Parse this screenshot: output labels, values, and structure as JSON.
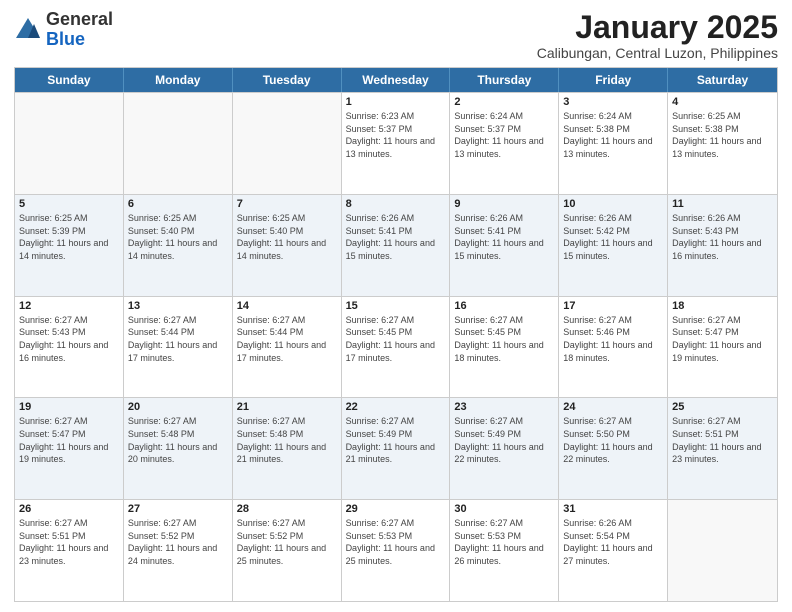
{
  "logo": {
    "general": "General",
    "blue": "Blue"
  },
  "header": {
    "month": "January 2025",
    "location": "Calibungan, Central Luzon, Philippines"
  },
  "weekdays": [
    "Sunday",
    "Monday",
    "Tuesday",
    "Wednesday",
    "Thursday",
    "Friday",
    "Saturday"
  ],
  "weeks": [
    [
      {
        "day": "",
        "sunrise": "",
        "sunset": "",
        "daylight": ""
      },
      {
        "day": "",
        "sunrise": "",
        "sunset": "",
        "daylight": ""
      },
      {
        "day": "",
        "sunrise": "",
        "sunset": "",
        "daylight": ""
      },
      {
        "day": "1",
        "sunrise": "Sunrise: 6:23 AM",
        "sunset": "Sunset: 5:37 PM",
        "daylight": "Daylight: 11 hours and 13 minutes."
      },
      {
        "day": "2",
        "sunrise": "Sunrise: 6:24 AM",
        "sunset": "Sunset: 5:37 PM",
        "daylight": "Daylight: 11 hours and 13 minutes."
      },
      {
        "day": "3",
        "sunrise": "Sunrise: 6:24 AM",
        "sunset": "Sunset: 5:38 PM",
        "daylight": "Daylight: 11 hours and 13 minutes."
      },
      {
        "day": "4",
        "sunrise": "Sunrise: 6:25 AM",
        "sunset": "Sunset: 5:38 PM",
        "daylight": "Daylight: 11 hours and 13 minutes."
      }
    ],
    [
      {
        "day": "5",
        "sunrise": "Sunrise: 6:25 AM",
        "sunset": "Sunset: 5:39 PM",
        "daylight": "Daylight: 11 hours and 14 minutes."
      },
      {
        "day": "6",
        "sunrise": "Sunrise: 6:25 AM",
        "sunset": "Sunset: 5:40 PM",
        "daylight": "Daylight: 11 hours and 14 minutes."
      },
      {
        "day": "7",
        "sunrise": "Sunrise: 6:25 AM",
        "sunset": "Sunset: 5:40 PM",
        "daylight": "Daylight: 11 hours and 14 minutes."
      },
      {
        "day": "8",
        "sunrise": "Sunrise: 6:26 AM",
        "sunset": "Sunset: 5:41 PM",
        "daylight": "Daylight: 11 hours and 15 minutes."
      },
      {
        "day": "9",
        "sunrise": "Sunrise: 6:26 AM",
        "sunset": "Sunset: 5:41 PM",
        "daylight": "Daylight: 11 hours and 15 minutes."
      },
      {
        "day": "10",
        "sunrise": "Sunrise: 6:26 AM",
        "sunset": "Sunset: 5:42 PM",
        "daylight": "Daylight: 11 hours and 15 minutes."
      },
      {
        "day": "11",
        "sunrise": "Sunrise: 6:26 AM",
        "sunset": "Sunset: 5:43 PM",
        "daylight": "Daylight: 11 hours and 16 minutes."
      }
    ],
    [
      {
        "day": "12",
        "sunrise": "Sunrise: 6:27 AM",
        "sunset": "Sunset: 5:43 PM",
        "daylight": "Daylight: 11 hours and 16 minutes."
      },
      {
        "day": "13",
        "sunrise": "Sunrise: 6:27 AM",
        "sunset": "Sunset: 5:44 PM",
        "daylight": "Daylight: 11 hours and 17 minutes."
      },
      {
        "day": "14",
        "sunrise": "Sunrise: 6:27 AM",
        "sunset": "Sunset: 5:44 PM",
        "daylight": "Daylight: 11 hours and 17 minutes."
      },
      {
        "day": "15",
        "sunrise": "Sunrise: 6:27 AM",
        "sunset": "Sunset: 5:45 PM",
        "daylight": "Daylight: 11 hours and 17 minutes."
      },
      {
        "day": "16",
        "sunrise": "Sunrise: 6:27 AM",
        "sunset": "Sunset: 5:45 PM",
        "daylight": "Daylight: 11 hours and 18 minutes."
      },
      {
        "day": "17",
        "sunrise": "Sunrise: 6:27 AM",
        "sunset": "Sunset: 5:46 PM",
        "daylight": "Daylight: 11 hours and 18 minutes."
      },
      {
        "day": "18",
        "sunrise": "Sunrise: 6:27 AM",
        "sunset": "Sunset: 5:47 PM",
        "daylight": "Daylight: 11 hours and 19 minutes."
      }
    ],
    [
      {
        "day": "19",
        "sunrise": "Sunrise: 6:27 AM",
        "sunset": "Sunset: 5:47 PM",
        "daylight": "Daylight: 11 hours and 19 minutes."
      },
      {
        "day": "20",
        "sunrise": "Sunrise: 6:27 AM",
        "sunset": "Sunset: 5:48 PM",
        "daylight": "Daylight: 11 hours and 20 minutes."
      },
      {
        "day": "21",
        "sunrise": "Sunrise: 6:27 AM",
        "sunset": "Sunset: 5:48 PM",
        "daylight": "Daylight: 11 hours and 21 minutes."
      },
      {
        "day": "22",
        "sunrise": "Sunrise: 6:27 AM",
        "sunset": "Sunset: 5:49 PM",
        "daylight": "Daylight: 11 hours and 21 minutes."
      },
      {
        "day": "23",
        "sunrise": "Sunrise: 6:27 AM",
        "sunset": "Sunset: 5:49 PM",
        "daylight": "Daylight: 11 hours and 22 minutes."
      },
      {
        "day": "24",
        "sunrise": "Sunrise: 6:27 AM",
        "sunset": "Sunset: 5:50 PM",
        "daylight": "Daylight: 11 hours and 22 minutes."
      },
      {
        "day": "25",
        "sunrise": "Sunrise: 6:27 AM",
        "sunset": "Sunset: 5:51 PM",
        "daylight": "Daylight: 11 hours and 23 minutes."
      }
    ],
    [
      {
        "day": "26",
        "sunrise": "Sunrise: 6:27 AM",
        "sunset": "Sunset: 5:51 PM",
        "daylight": "Daylight: 11 hours and 23 minutes."
      },
      {
        "day": "27",
        "sunrise": "Sunrise: 6:27 AM",
        "sunset": "Sunset: 5:52 PM",
        "daylight": "Daylight: 11 hours and 24 minutes."
      },
      {
        "day": "28",
        "sunrise": "Sunrise: 6:27 AM",
        "sunset": "Sunset: 5:52 PM",
        "daylight": "Daylight: 11 hours and 25 minutes."
      },
      {
        "day": "29",
        "sunrise": "Sunrise: 6:27 AM",
        "sunset": "Sunset: 5:53 PM",
        "daylight": "Daylight: 11 hours and 25 minutes."
      },
      {
        "day": "30",
        "sunrise": "Sunrise: 6:27 AM",
        "sunset": "Sunset: 5:53 PM",
        "daylight": "Daylight: 11 hours and 26 minutes."
      },
      {
        "day": "31",
        "sunrise": "Sunrise: 6:26 AM",
        "sunset": "Sunset: 5:54 PM",
        "daylight": "Daylight: 11 hours and 27 minutes."
      },
      {
        "day": "",
        "sunrise": "",
        "sunset": "",
        "daylight": ""
      }
    ]
  ]
}
